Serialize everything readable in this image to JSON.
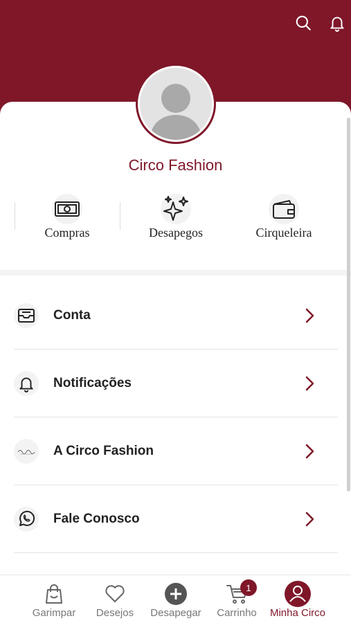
{
  "profile": {
    "name": "Circo Fashion"
  },
  "quick_actions": [
    {
      "label": "Compras",
      "icon": "banknote-icon"
    },
    {
      "label": "Desapegos",
      "icon": "sparkles-icon"
    },
    {
      "label": "Cirqueleira",
      "icon": "wallet-icon"
    }
  ],
  "menu": [
    {
      "label": "Conta",
      "icon": "inbox-icon"
    },
    {
      "label": "Notificações",
      "icon": "bell-icon"
    },
    {
      "label": "A Circo Fashion",
      "icon": "circo-logo"
    },
    {
      "label": "Fale Conosco",
      "icon": "whatsapp-icon"
    }
  ],
  "bottom_nav": [
    {
      "label": "Garimpar",
      "icon": "shopping-bag-icon"
    },
    {
      "label": "Desejos",
      "icon": "heart-icon"
    },
    {
      "label": "Desapegar",
      "icon": "plus-circle-icon"
    },
    {
      "label": "Carrinho",
      "icon": "cart-icon",
      "badge": "1"
    },
    {
      "label": "Minha Circo",
      "icon": "user-icon",
      "active": true
    }
  ],
  "colors": {
    "brand": "#7f1729",
    "nav_inactive": "#777777"
  }
}
